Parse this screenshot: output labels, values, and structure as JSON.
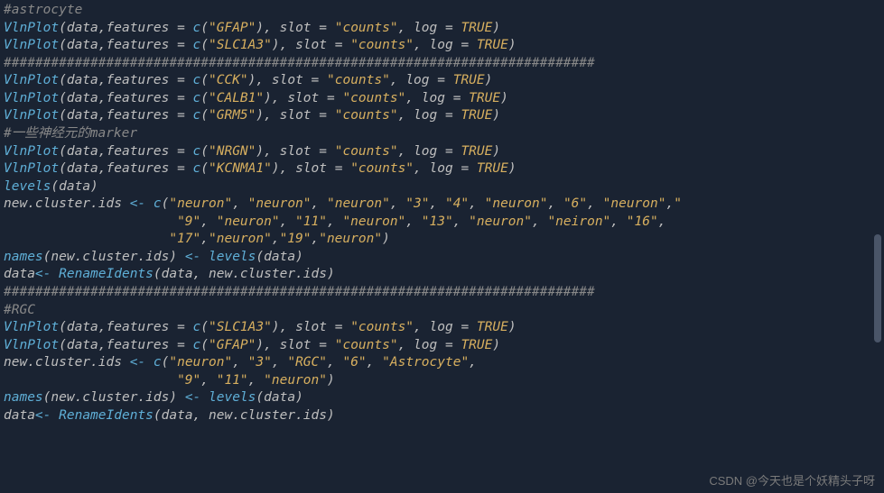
{
  "lines": [
    {
      "type": "comment",
      "text": "#astrocyte"
    },
    {
      "type": "vln",
      "gene": "GFAP"
    },
    {
      "type": "vln",
      "gene": "SLC1A3"
    },
    {
      "type": "hashline"
    },
    {
      "type": "vln",
      "gene": "CCK"
    },
    {
      "type": "vln",
      "gene": "CALB1"
    },
    {
      "type": "vln",
      "gene": "GRM5"
    },
    {
      "type": "comment",
      "text": "#一些神经元的marker"
    },
    {
      "type": "vln",
      "gene": "NRGN"
    },
    {
      "type": "vln",
      "gene": "KCNMA1"
    },
    {
      "type": "levels"
    },
    {
      "type": "cluster1a",
      "items": [
        "neuron",
        "neuron",
        "neuron",
        "3",
        "4",
        "neuron",
        "6",
        "neuron"
      ],
      "trail": ",\""
    },
    {
      "type": "cluster1b",
      "items": [
        "9",
        "neuron",
        "11",
        "neuron",
        "13",
        "neuron",
        "neiron",
        "16"
      ]
    },
    {
      "type": "cluster1c",
      "items": [
        "17",
        "neuron",
        "19",
        "neuron"
      ]
    },
    {
      "type": "names"
    },
    {
      "type": "rename"
    },
    {
      "type": "hashline"
    },
    {
      "type": "comment",
      "text": "#RGC"
    },
    {
      "type": "vln",
      "gene": "SLC1A3"
    },
    {
      "type": "vln",
      "gene": "GFAP"
    },
    {
      "type": "cluster2a",
      "items": [
        "neuron",
        "3",
        "RGC",
        "6",
        "Astrocyte"
      ]
    },
    {
      "type": "cluster2b",
      "items": [
        "9",
        "11",
        "neuron"
      ]
    },
    {
      "type": "names"
    },
    {
      "type": "rename"
    }
  ],
  "tokens": {
    "vlnplot": "VlnPlot",
    "data": "data",
    "features": "features",
    "c": "c",
    "slot": "slot",
    "slotval": "counts",
    "log": "log",
    "true": "TRUE",
    "levels": "levels",
    "newcluster": "new.cluster.ids",
    "names": "names",
    "rename": "RenameIdents",
    "hashrow": "###########################################################################"
  },
  "watermark": "CSDN @今天也是个妖精头子呀"
}
